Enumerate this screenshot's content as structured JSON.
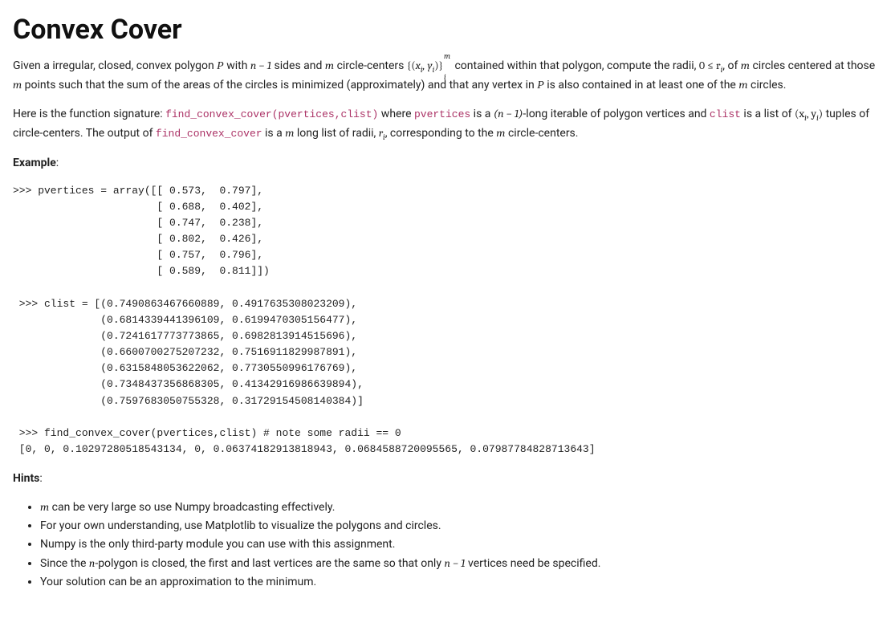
{
  "title": "Convex Cover",
  "intro": {
    "p1a": "Given a irregular, closed, convex polygon ",
    "scriptP": "P",
    "p1b": " with ",
    "n_minus_1": "n − 1",
    "p1c": " sides and ",
    "m": "m",
    "p1d": " circle-centers ",
    "set_open": "{(",
    "xi": "x",
    "comma_yi": ", y",
    "set_close": ")}",
    "sup_m": "m",
    "sub_i": "i",
    "p1e": " contained within that polygon, compute the radii, ",
    "ineq": "0 ≤ r",
    "p1f": ", of ",
    "p2a": " circles centered at those ",
    "p2b": " points such that the sum of the areas of the circles is minimized (approximately) and that any vertex in ",
    "p2c": " is also contained in at least one of the ",
    "p2d": " circles."
  },
  "signature": {
    "lead": "Here is the function signature: ",
    "fn": "find_convex_cover(pvertices,clist)",
    "where": " where ",
    "pvertices": "pvertices",
    "is_a": " is a ",
    "n_minus_1_paren": "(n − 1)",
    "long_iter": "-long iterable of polygon vertices and ",
    "clist": "clist",
    "is_list": " is a list of ",
    "tuple_open": "(x",
    "tuple_mid": ", y",
    "tuple_close": ")",
    "tuples_of": " tuples of circle-centers. The output of ",
    "fn2": "find_convex_cover",
    "is_m_long": " is a ",
    "long_radii": " long list of radii, ",
    "r": "r",
    "corresp": ", corresponding to the ",
    "circ_centers": " circle-centers."
  },
  "labels": {
    "example": "Example",
    "hints": "Hints"
  },
  "code": {
    "block1": ">>> pvertices = array([[ 0.573,  0.797],\n                       [ 0.688,  0.402],\n                       [ 0.747,  0.238],\n                       [ 0.802,  0.426],\n                       [ 0.757,  0.796],\n                       [ 0.589,  0.811]])\n\n >>> clist = [(0.7490863467660889, 0.4917635308023209),\n              (0.6814339441396109, 0.6199470305156477),\n              (0.7241617773773865, 0.6982813914515696),\n              (0.6600700275207232, 0.7516911829987891),\n              (0.6315848053622062, 0.7730550996176769),\n              (0.7348437356868305, 0.41342916986639894),\n              (0.7597683050755328, 0.31729154508140384)]\n\n >>> find_convex_cover(pvertices,clist) # note some radii == 0\n [0, 0, 0.10297280518543134, 0, 0.06374182913818943, 0.0684588720095565, 0.07987784828713643]"
  },
  "hints": {
    "h1a": " can be very large so use Numpy broadcasting effectively.",
    "h2": "For your own understanding, use Matplotlib to visualize the polygons and circles.",
    "h3": "Numpy is the only third-party module you can use with this assignment.",
    "h4a": "Since the ",
    "h4_n": "n",
    "h4b": "-polygon is closed, the first and last vertices are the same so that only ",
    "h4c": " vertices need be specified.",
    "h5": "Your solution can be an approximation to the minimum."
  }
}
